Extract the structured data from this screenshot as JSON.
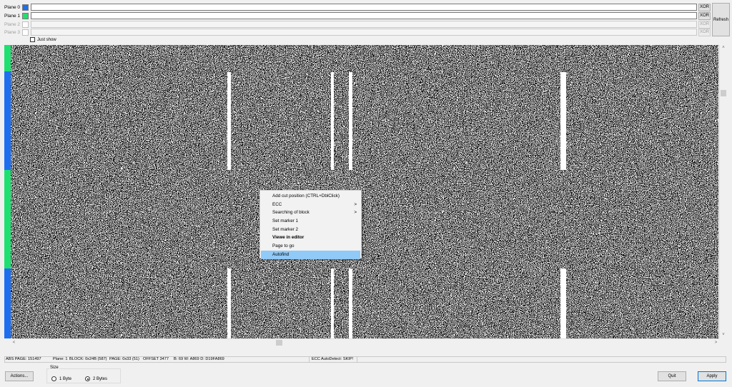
{
  "planes": [
    {
      "label": "Plane 0",
      "color": "#1e6ff0",
      "enabled": true,
      "xor_label": "XOR"
    },
    {
      "label": "Plane 1",
      "color": "#1ee070",
      "enabled": true,
      "xor_label": "XOR"
    },
    {
      "label": "Plane 2",
      "color": "#ffffff",
      "enabled": false,
      "xor_label": "XOR"
    },
    {
      "label": "Plane 3",
      "color": "#ffffff",
      "enabled": false,
      "xor_label": "XOR"
    }
  ],
  "refresh_label": "Refresh",
  "just_show": {
    "label": "Just show",
    "checked": false
  },
  "plane_strip_colors": {
    "plane0": "#1e6ff0",
    "plane1": "#1ee070"
  },
  "context_menu": {
    "items": [
      {
        "label": "Add cut position (CTRL+DblClick)",
        "submenu": false,
        "bold": false,
        "highlighted": false
      },
      {
        "label": "ECC",
        "submenu": true,
        "bold": false,
        "highlighted": false
      },
      {
        "label": "Searching of block",
        "submenu": true,
        "bold": false,
        "highlighted": false
      },
      {
        "label": "Set marker 1",
        "submenu": false,
        "bold": false,
        "highlighted": false
      },
      {
        "label": "Set marker 2",
        "submenu": false,
        "bold": false,
        "highlighted": false
      },
      {
        "label": "Viewe in editor",
        "submenu": false,
        "bold": true,
        "highlighted": false
      },
      {
        "label": "Page to go",
        "submenu": false,
        "bold": false,
        "highlighted": false
      },
      {
        "label": "Autofind",
        "submenu": false,
        "bold": false,
        "highlighted": true
      }
    ],
    "submenu_arrow": ">"
  },
  "status": {
    "abs_page": "ABS PAGE: 151497",
    "plane": "Plane: 1",
    "block": "BLOCK: 0x24B (587)",
    "page": "PAGE: 0x33 (51)",
    "offset": "OFFSET 3477",
    "bytes": "B: 69 W: A869 D: D19FA869",
    "ecc": "ECC AutoDetect: SKIP!"
  },
  "buttons": {
    "actions": "Actions...",
    "quit": "Quit",
    "apply": "Apply"
  },
  "size_group": {
    "legend": "Size",
    "options": [
      {
        "label": "1 Byte",
        "checked": false
      },
      {
        "label": "2 Bytes",
        "checked": true
      }
    ]
  },
  "scroll_arrows": {
    "up": "˄",
    "down": "˅",
    "left": "<",
    "right": ">"
  }
}
